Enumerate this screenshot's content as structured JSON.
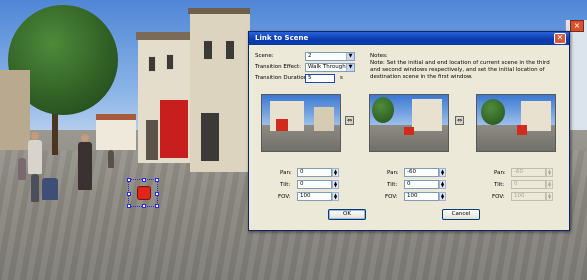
{
  "dialog": {
    "title": "Link to Scene",
    "close_glyph": "✕",
    "scene_label": "Scene:",
    "scene_value": "2",
    "transition_label": "Transition Effect:",
    "transition_value": "Walk Through",
    "duration_label": "Transition Duration:",
    "duration_value": "5",
    "duration_unit": "s",
    "notes_label": "Notes:",
    "notes_text": "Note: Set the initial and end location of current scene in the third and second windows respectively, and set the initial location of destination scene in the first window.",
    "columns": [
      {
        "pan_label": "Pan:",
        "pan": "0",
        "tilt_label": "Tilt:",
        "tilt": "0",
        "fov_label": "FOV:",
        "fov": "100",
        "enabled": true
      },
      {
        "pan_label": "Pan:",
        "pan": "-60",
        "tilt_label": "Tilt:",
        "tilt": "0",
        "fov_label": "FOV:",
        "fov": "100",
        "enabled": true
      },
      {
        "pan_label": "Pan:",
        "pan": "-60",
        "tilt_label": "Tilt:",
        "tilt": "0",
        "fov_label": "FOV:",
        "fov": "100",
        "enabled": false
      }
    ],
    "ok_label": "OK",
    "cancel_label": "Cancel"
  },
  "icons": {
    "dropdown": "chevron-down-icon",
    "spin": "spin-arrows-icon",
    "link": "link-icon",
    "hotspot": "hotspot-marker-icon"
  },
  "colors": {
    "titlebar": "#0a3db4",
    "dialog_bg": "#ece9d8",
    "hotspot": "#e0261a"
  }
}
